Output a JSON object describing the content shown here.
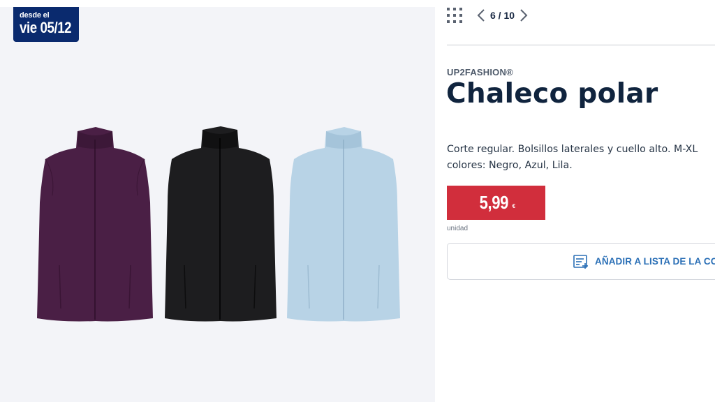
{
  "badge": {
    "line1": "desde el",
    "line2": "vie 05/12"
  },
  "gallery": {
    "counter": "6 / 10",
    "vests": [
      {
        "name": "Lila",
        "color": "#4a1f45"
      },
      {
        "name": "Negro",
        "color": "#1d1d1f"
      },
      {
        "name": "Azul",
        "color": "#b8d3e6"
      }
    ]
  },
  "product": {
    "brand": "UP2FASHION®",
    "title": "Chaleco polar",
    "description_line1": "Corte regular. Bolsillos laterales y cuello alto. M-XL",
    "description_line2": "colores: Negro, Azul, Lila.",
    "price": "5,99",
    "currency": "€",
    "unit": "unidad",
    "add_to_list_label": "AÑADIR A LISTA DE LA CO"
  },
  "colors": {
    "price_red": "#d12e3c",
    "badge_navy": "#0a2a6e",
    "link_blue": "#2a6fb6",
    "title_navy": "#10243e"
  },
  "icons": [
    "grid-icon",
    "chevron-left-icon",
    "chevron-right-icon",
    "shopping-list-icon"
  ]
}
